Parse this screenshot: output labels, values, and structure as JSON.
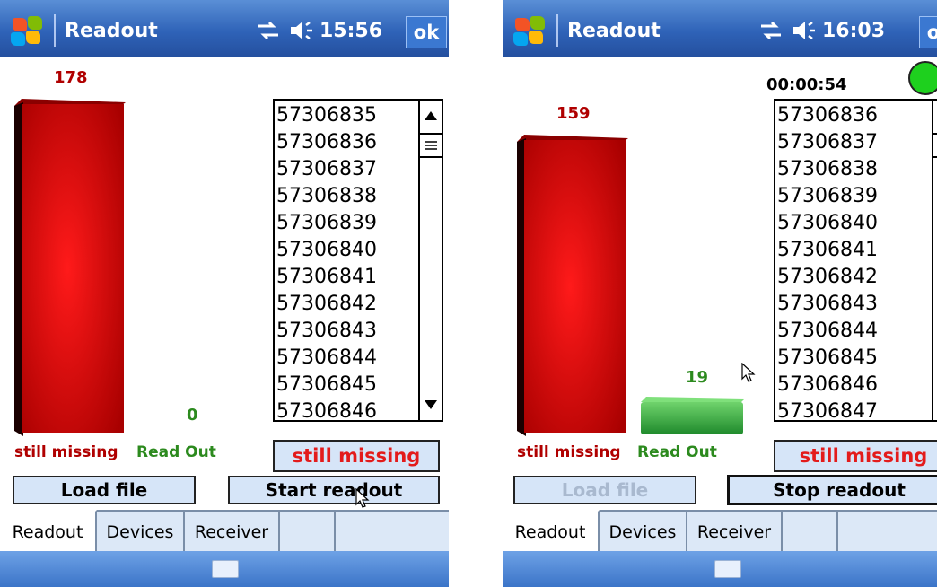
{
  "colors": {
    "titlebar": "#2f63b8",
    "missing_bar": "#d60000",
    "readout_bar": "#2fae3b",
    "missing_text": "#e31b1b",
    "readout_text": "#2c8a1e"
  },
  "screen1": {
    "title": "Readout",
    "time": "15:56",
    "ok": "ok",
    "missing_count": "178",
    "readout_count": "0",
    "missing_fraction": 1.0,
    "list_items": [
      "57306835",
      "57306836",
      "57306837",
      "57306838",
      "57306839",
      "57306840",
      "57306841",
      "57306842",
      "57306843",
      "57306844",
      "57306845",
      "57306846"
    ],
    "label_missing": "still missing",
    "label_readout": "Read Out",
    "status_button": "still missing",
    "load_button": "Load file",
    "action_button": "Start readout",
    "tabs": [
      "Readout",
      "Devices",
      "Receiver",
      ""
    ]
  },
  "screen2": {
    "title": "Readout",
    "time": "16:03",
    "ok": "ok",
    "timer": "00:00:54",
    "missing_count": "159",
    "readout_count": "19",
    "list_items": [
      "57306836",
      "57306837",
      "57306838",
      "57306839",
      "57306840",
      "57306841",
      "57306842",
      "57306843",
      "57306844",
      "57306845",
      "57306846",
      "57306847"
    ],
    "label_missing": "still missing",
    "label_readout": "Read Out",
    "status_button": "still missing",
    "load_button": "Load file",
    "action_button": "Stop readout",
    "tabs": [
      "Readout",
      "Devices",
      "Receiver",
      ""
    ]
  }
}
